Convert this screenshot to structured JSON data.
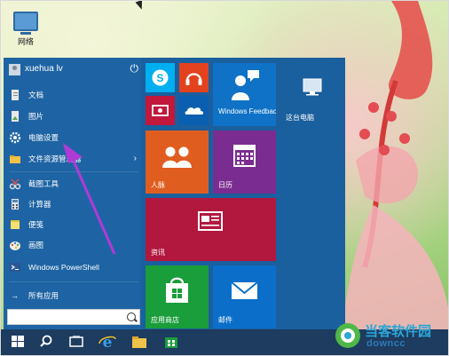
{
  "desktop": {
    "network_icon_label": "网络"
  },
  "start_menu": {
    "user_name": "xuehua lv",
    "items": [
      {
        "label": "文档",
        "icon": "document-icon"
      },
      {
        "label": "图片",
        "icon": "pictures-icon"
      },
      {
        "label": "电脑设置",
        "icon": "settings-gear-icon"
      },
      {
        "label": "文件资源管理器",
        "icon": "file-explorer-icon",
        "has_arrow": true
      },
      {
        "label": "截图工具",
        "icon": "snipping-tool-icon"
      },
      {
        "label": "计算器",
        "icon": "calculator-icon"
      },
      {
        "label": "便笺",
        "icon": "sticky-notes-icon"
      },
      {
        "label": "画图",
        "icon": "paint-icon"
      },
      {
        "label": "Windows PowerShell",
        "icon": "powershell-icon"
      }
    ],
    "all_apps_label": "所有应用",
    "search_placeholder": ""
  },
  "tiles": {
    "windows_feedback": "Windows Feedback",
    "this_pc": "这台电脑",
    "people": "人脉",
    "calendar": "日历",
    "news": "资讯",
    "store": "应用商店",
    "mail": "邮件"
  },
  "watermark": {
    "brand": "当客软件园",
    "url": "downcc"
  },
  "colors": {
    "start_bg": "#1a5f9e",
    "skype": "#00aff0",
    "music": "#e3421f",
    "video": "#c1183b",
    "onedrive": "#0a5fb0",
    "feedback": "#0f72c6",
    "people": "#e05d20",
    "calendar": "#7b2c90",
    "news": "#b2173e",
    "store": "#1a9d3b",
    "mail": "#0b6fc9",
    "taskbar": "#1d3c5f",
    "arrow": "#b03ad6"
  }
}
